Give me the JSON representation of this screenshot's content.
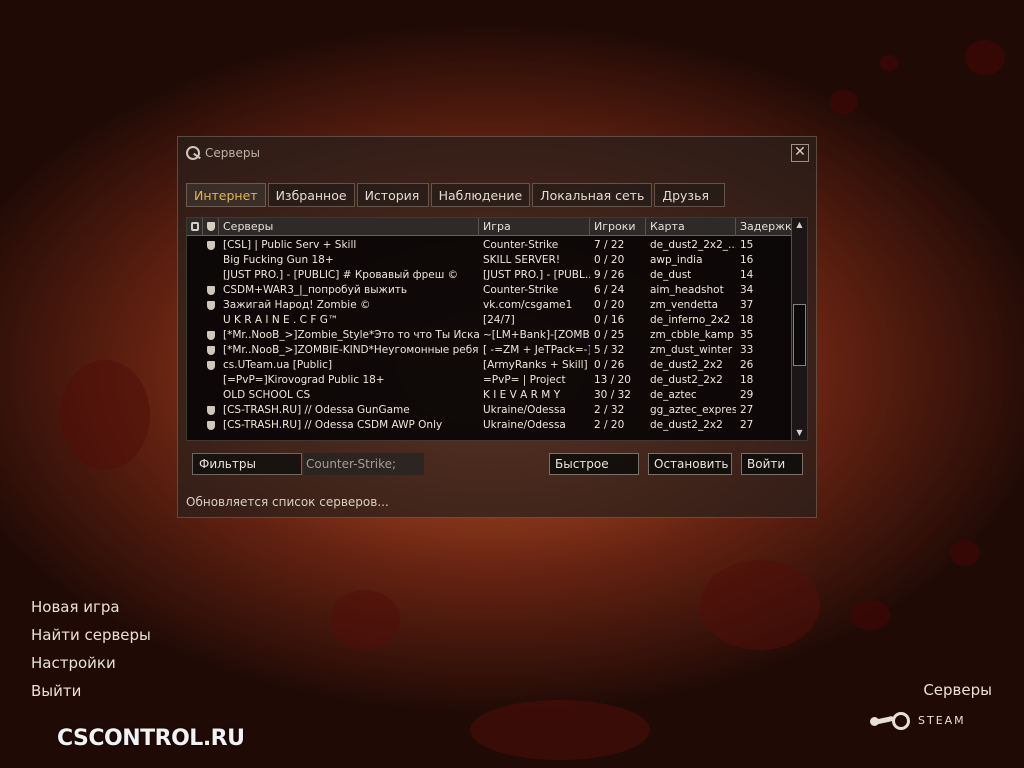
{
  "dialog": {
    "title": "Серверы",
    "close_label": "✕",
    "tabs": [
      "Интернет",
      "Избранное",
      "История",
      "Наблюдение",
      "Локальная сеть",
      "Друзья"
    ],
    "active_tab": 0,
    "columns": [
      "Серверы",
      "Игра",
      "Игроки",
      "Карта",
      "Задержка"
    ],
    "rows": [
      {
        "shield": true,
        "name": "[CSL] | Public Serv + Skill",
        "game": "Counter-Strike",
        "players": "7 / 22",
        "map": "de_dust2_2x2_...",
        "ping": "15"
      },
      {
        "shield": false,
        "name": "Big Fucking Gun 18+",
        "game": "SKILL SERVER!",
        "players": "0 / 20",
        "map": "awp_india",
        "ping": "16"
      },
      {
        "shield": false,
        "name": "[JUST PRO.] - [PUBLIC] # Кровавый фреш ©",
        "game": "[JUST PRO.] - [PUBL...",
        "players": "9 / 26",
        "map": "de_dust",
        "ping": "14"
      },
      {
        "shield": true,
        "name": "CSDM+WAR3_|_попробуй выжить",
        "game": "Counter-Strike",
        "players": "6 / 24",
        "map": "aim_headshot",
        "ping": "34"
      },
      {
        "shield": true,
        "name": "Зажигай Народ! Zombie ©",
        "game": "vk.com/csgame1",
        "players": "0 / 20",
        "map": "zm_vendetta",
        "ping": "37"
      },
      {
        "shield": false,
        "name": "U K R A I N E . C F G™",
        "game": "[24/7]",
        "players": "0 / 16",
        "map": "de_inferno_2x2",
        "ping": "18"
      },
      {
        "shield": true,
        "name": "[*Mr..NooB_>]Zombie_Style*Это то что Ты Искал ©",
        "game": "~[LM+Bank]-[ZOMBI...",
        "players": "0 / 25",
        "map": "zm_cbble_kamp",
        "ping": "35"
      },
      {
        "shield": true,
        "name": "[*Mr..NooB_>]ZOMBIE-KIND*Неугомонные ребят...",
        "game": "[ -=ZM + JeTPack=-]",
        "players": "5 / 32",
        "map": "zm_dust_winter",
        "ping": "33"
      },
      {
        "shield": true,
        "name": "cs.UTeam.ua [Public]",
        "game": "[ArmyRanks + Skill]",
        "players": "0 / 26",
        "map": "de_dust2_2x2",
        "ping": "26"
      },
      {
        "shield": false,
        "name": "[=PvP=]Kirovograd Public 18+",
        "game": "=PvP= | Project",
        "players": "13 / 20",
        "map": "de_dust2_2x2",
        "ping": "18"
      },
      {
        "shield": false,
        "name": "OLD SCHOOL CS",
        "game": "K I E V   A R M Y",
        "players": "30 / 32",
        "map": "de_aztec",
        "ping": "29"
      },
      {
        "shield": true,
        "name": "[CS-TRASH.RU] // Odessa GunGame",
        "game": "Ukraine/Odessa",
        "players": "2 / 32",
        "map": "gg_aztec_express",
        "ping": "27"
      },
      {
        "shield": true,
        "name": "[CS-TRASH.RU] // Odessa CSDM AWP Only",
        "game": "Ukraine/Odessa",
        "players": "2 / 20",
        "map": "de_dust2_2x2",
        "ping": "27"
      }
    ],
    "filters_label": "Фильтры",
    "filter_value": "Counter-Strike;",
    "quick_label": "Быстрое",
    "stop_label": "Остановить",
    "connect_label": "Войти",
    "status": "Обновляется список серверов..."
  },
  "menu": {
    "items": [
      "Новая игра",
      "Найти серверы",
      "Настройки",
      "Выйти"
    ]
  },
  "brand": "CSCONTROL.RU",
  "servers_link": "Серверы",
  "steam_label": "STEAM"
}
